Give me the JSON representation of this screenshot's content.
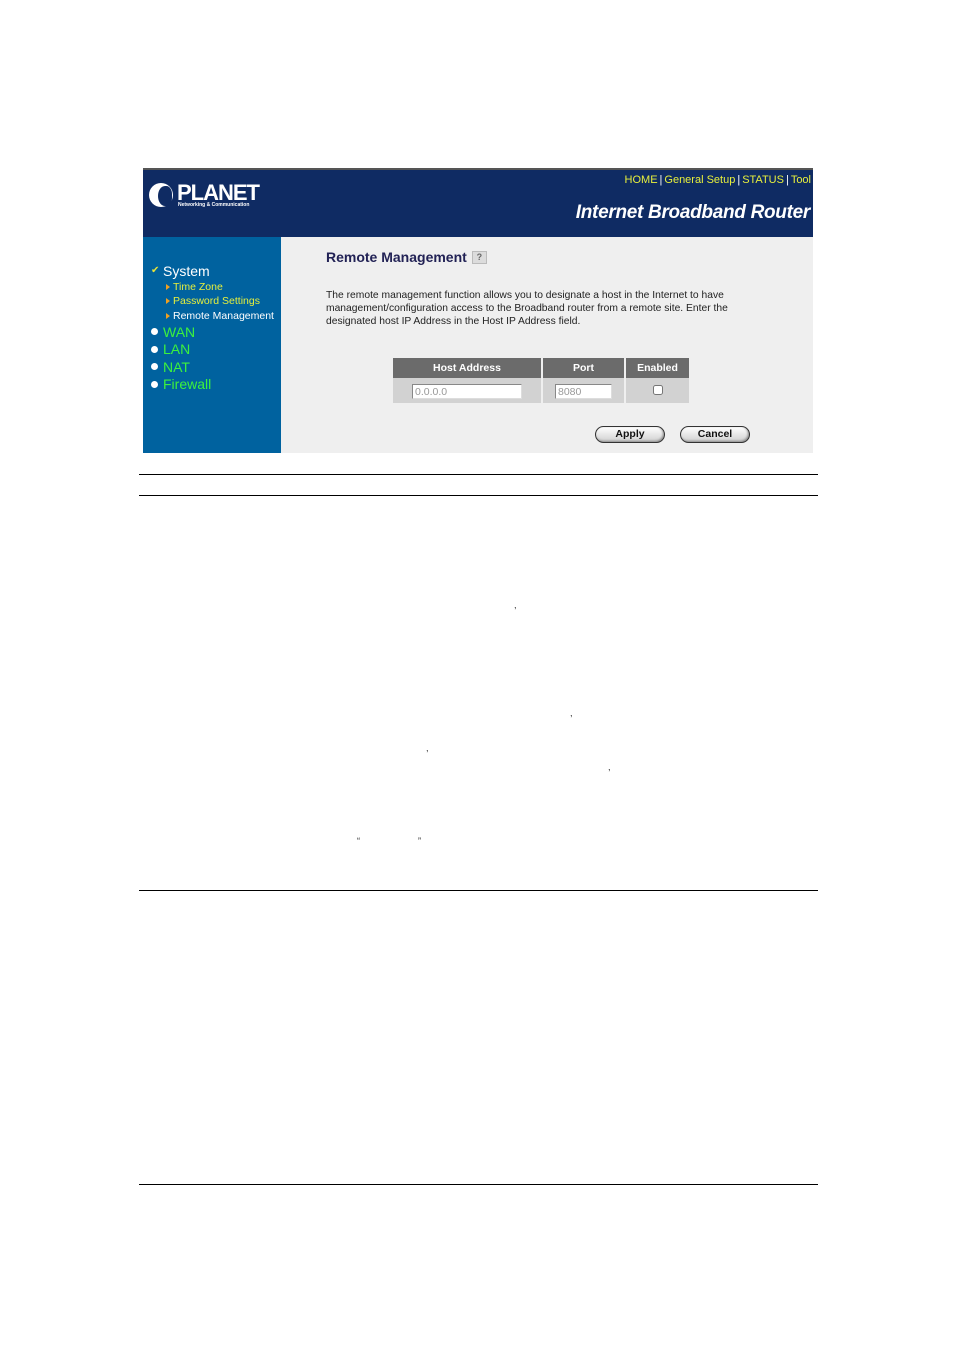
{
  "header": {
    "logo_text": "PLANET",
    "logo_tagline": "Networking & Communication",
    "nav": [
      "HOME",
      "General Setup",
      "STATUS",
      "Tool"
    ],
    "product_title": "Internet Broadband Router"
  },
  "sidebar": {
    "items": [
      {
        "label": "System",
        "icon": "checkmark-icon",
        "active": true,
        "children": [
          {
            "label": "Time Zone"
          },
          {
            "label": "Password Settings"
          },
          {
            "label": "Remote Management",
            "current": true
          }
        ]
      },
      {
        "label": "WAN",
        "icon": "bullet-icon"
      },
      {
        "label": "LAN",
        "icon": "bullet-icon"
      },
      {
        "label": "NAT",
        "icon": "bullet-icon"
      },
      {
        "label": "Firewall",
        "icon": "bullet-icon"
      }
    ]
  },
  "main": {
    "title": "Remote Management",
    "help_icon": "help-icon",
    "description": "The remote management function allows you to designate a host in the Internet to have management/configuration access to the Broadband router from a remote site. Enter the designated host IP Address in the Host IP Address field.",
    "table": {
      "headers": [
        "Host Address",
        "Port",
        "Enabled"
      ],
      "row": {
        "host_address": "0.0.0.0",
        "port": "8080",
        "enabled": false
      }
    },
    "buttons": {
      "apply": "Apply",
      "cancel": "Cancel"
    }
  },
  "document": {
    "stray_marks": [
      ",",
      ",",
      ",",
      ",",
      "“",
      "”"
    ]
  }
}
